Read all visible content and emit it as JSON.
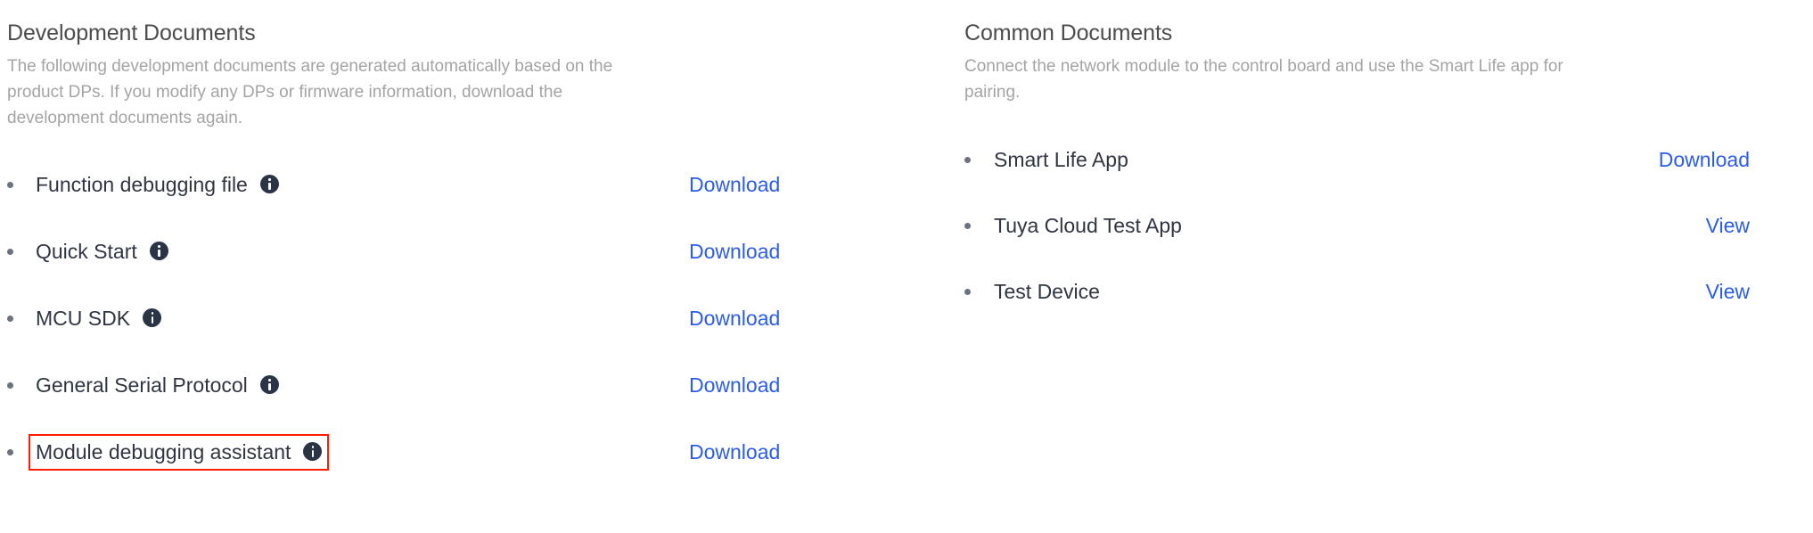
{
  "left_column": {
    "title": "Development Documents",
    "description": "The following development documents are generated automatically based on the product DPs. If you modify any DPs or firmware information, download the development documents again.",
    "items": [
      {
        "label": "Function debugging file",
        "info_icon": "info-icon",
        "action": "Download",
        "highlighted": false
      },
      {
        "label": "Quick Start",
        "info_icon": "info-icon",
        "action": "Download",
        "highlighted": false
      },
      {
        "label": "MCU SDK",
        "info_icon": "info-icon",
        "action": "Download",
        "highlighted": false
      },
      {
        "label": "General Serial Protocol",
        "info_icon": "info-icon",
        "action": "Download",
        "highlighted": false
      },
      {
        "label": "Module debugging assistant",
        "info_icon": "info-icon",
        "action": "Download",
        "highlighted": true
      }
    ]
  },
  "right_column": {
    "title": "Common Documents",
    "description": "Connect the network module to the control board and use the Smart Life app for pairing.",
    "items": [
      {
        "label": "Smart Life App",
        "info_icon": null,
        "action": "Download",
        "highlighted": false
      },
      {
        "label": "Tuya Cloud Test App",
        "info_icon": null,
        "action": "View",
        "highlighted": false
      },
      {
        "label": "Test Device",
        "info_icon": null,
        "action": "View",
        "highlighted": false
      }
    ]
  },
  "colors": {
    "link": "#2b5ced",
    "highlight_border": "#ff1a00",
    "heading": "#4c4c4c",
    "description": "#a4a4a4",
    "label": "#2f3542",
    "info_icon_bg": "#2b3445",
    "bullet": "#6b7280",
    "background": "#ffffff"
  }
}
